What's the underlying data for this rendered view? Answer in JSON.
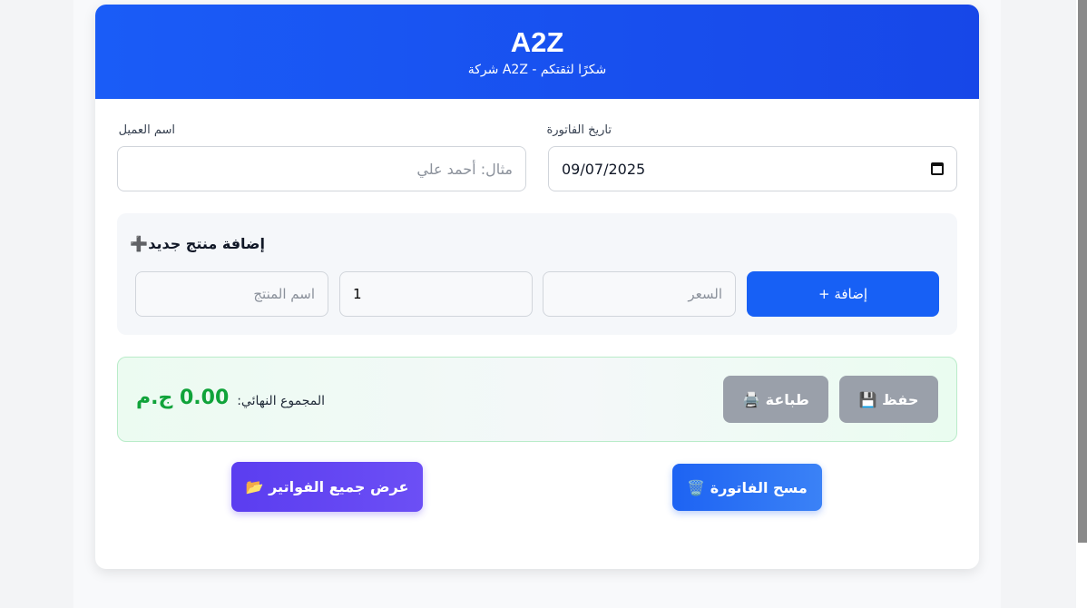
{
  "header": {
    "brand": "A2Z",
    "tagline": "شكرًا لثقتكم - A2Z شركة"
  },
  "form": {
    "customer_label": "اسم العميل",
    "customer_placeholder": "مثال: أحمد علي",
    "date_label": "تاريخ الفاتورة",
    "date_value": "09/07/2025"
  },
  "add_product": {
    "title": "إضافة منتج جديد➕",
    "name_placeholder": "اسم المنتج",
    "quantity_value": "1",
    "price_placeholder": "السعر",
    "add_button": "إضافة +"
  },
  "summary": {
    "save_button": "حفظ 💾",
    "print_button": "طباعة 🖨️",
    "total_label": "المجموع النهائي:",
    "total_value": "0.00 ج.م"
  },
  "actions": {
    "clear_button": "مسح الفاتورة 🗑️",
    "all_invoices_button": "عرض جميع الفواتير 📂"
  },
  "colors": {
    "primary": "#1760f5",
    "header": "#1747e8",
    "total_green": "#10a33a",
    "muted_button": "#9aa0aa",
    "purple": "#5b3df0"
  }
}
